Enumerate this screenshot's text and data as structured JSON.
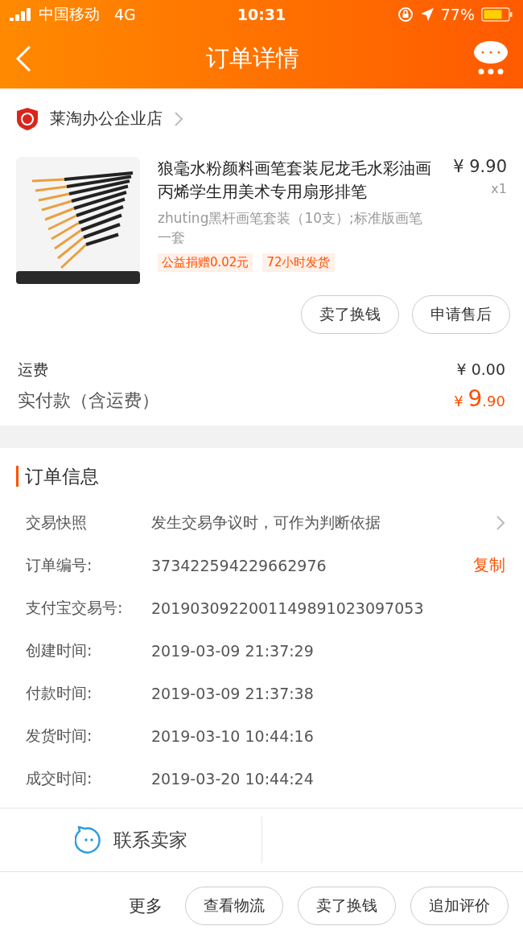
{
  "status_bar": {
    "carrier": "中国移动",
    "network": "4G",
    "time": "10:31",
    "battery": "77%"
  },
  "nav": {
    "title": "订单详情"
  },
  "shop": {
    "name": "莱淘办公企业店"
  },
  "product": {
    "title": "狼毫水粉颜料画笔套装尼龙毛水彩油画丙烯学生用美术专用扇形排笔",
    "price": "¥ 9.90",
    "quantity": "x1",
    "sku": "zhuting黑杆画笔套装（10支）;标准版画笔一套",
    "tags": [
      "公益捐赠0.02元",
      "72小时发货"
    ]
  },
  "item_actions": [
    "卖了换钱",
    "申请售后"
  ],
  "fees": [
    {
      "label": "运费",
      "value": "¥ 0.00",
      "kind": "plain"
    },
    {
      "label": "实付款（含运费）",
      "currency": "¥ ",
      "integer": "9",
      "decimal": ".90",
      "kind": "total"
    }
  ],
  "order_info": {
    "title": "订单信息",
    "rows": [
      {
        "label": "交易快照",
        "value": "发生交易争议时，可作为判断依据",
        "kind": "link"
      },
      {
        "label": "订单编号:",
        "value": "373422594229662976",
        "action": "复制",
        "kind": "copy"
      },
      {
        "label": "支付宝交易号:",
        "value": "2019030922001149891023097053",
        "kind": "plain"
      },
      {
        "label": "创建时间:",
        "value": "2019-03-09 21:37:29",
        "kind": "plain"
      },
      {
        "label": "付款时间:",
        "value": "2019-03-09 21:37:38",
        "kind": "plain"
      },
      {
        "label": "发货时间:",
        "value": "2019-03-10 10:44:16",
        "kind": "plain"
      },
      {
        "label": "成交时间:",
        "value": "2019-03-20 10:44:24",
        "kind": "plain"
      }
    ]
  },
  "contact": {
    "label": "联系卖家"
  },
  "bottom_bar": {
    "more": "更多",
    "buttons": [
      "查看物流",
      "卖了换钱",
      "追加评价"
    ]
  }
}
